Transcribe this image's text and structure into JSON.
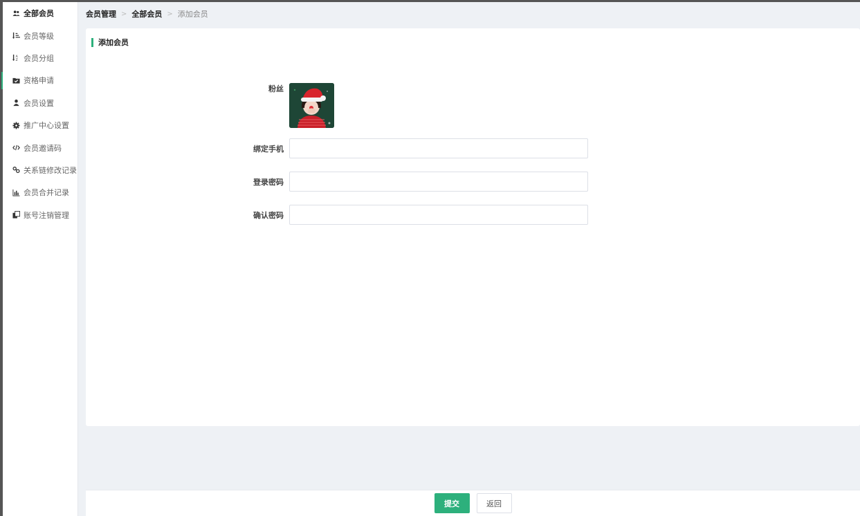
{
  "sidebar": {
    "items": [
      {
        "label": "全部会员",
        "icon": "users-icon"
      },
      {
        "label": "会员等级",
        "icon": "sort-amount-icon"
      },
      {
        "label": "会员分组",
        "icon": "sort-alpha-icon"
      },
      {
        "label": "资格申请",
        "icon": "folder-check-icon"
      },
      {
        "label": "会员设置",
        "icon": "user-icon"
      },
      {
        "label": "推广中心设置",
        "icon": "gear-icon"
      },
      {
        "label": "会员邀请码",
        "icon": "code-icon"
      },
      {
        "label": "关系链修改记录",
        "icon": "link-icon"
      },
      {
        "label": "会员合并记录",
        "icon": "bar-chart-icon"
      },
      {
        "label": "账号注销管理",
        "icon": "clone-icon"
      }
    ]
  },
  "breadcrumb": {
    "items": [
      "会员管理",
      "全部会员",
      "添加会员"
    ],
    "separator": ">"
  },
  "card": {
    "title": "添加会员"
  },
  "form": {
    "fans_label": "粉丝",
    "phone_label": "绑定手机",
    "phone_value": "",
    "password_label": "登录密码",
    "password_value": "",
    "confirm_label": "确认密码",
    "confirm_value": ""
  },
  "footer": {
    "submit_label": "提交",
    "back_label": "返回"
  },
  "colors": {
    "accent": "#2db07c",
    "background": "#eef1f5"
  }
}
